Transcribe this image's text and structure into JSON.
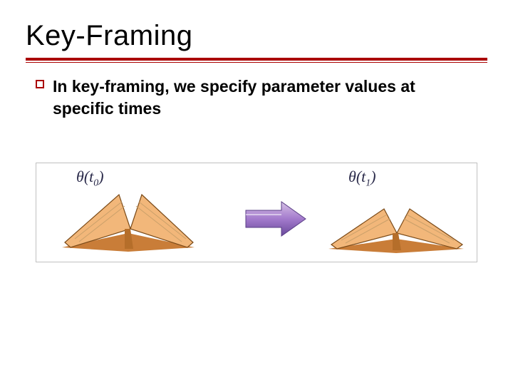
{
  "title": "Key-Framing",
  "bullet": "In key-framing, we specify parameter values at specific times",
  "diagram": {
    "label0": {
      "symbol": "θ",
      "arg": "t",
      "sub": "0"
    },
    "label1": {
      "symbol": "θ",
      "arg": "t",
      "sub": "1"
    }
  }
}
